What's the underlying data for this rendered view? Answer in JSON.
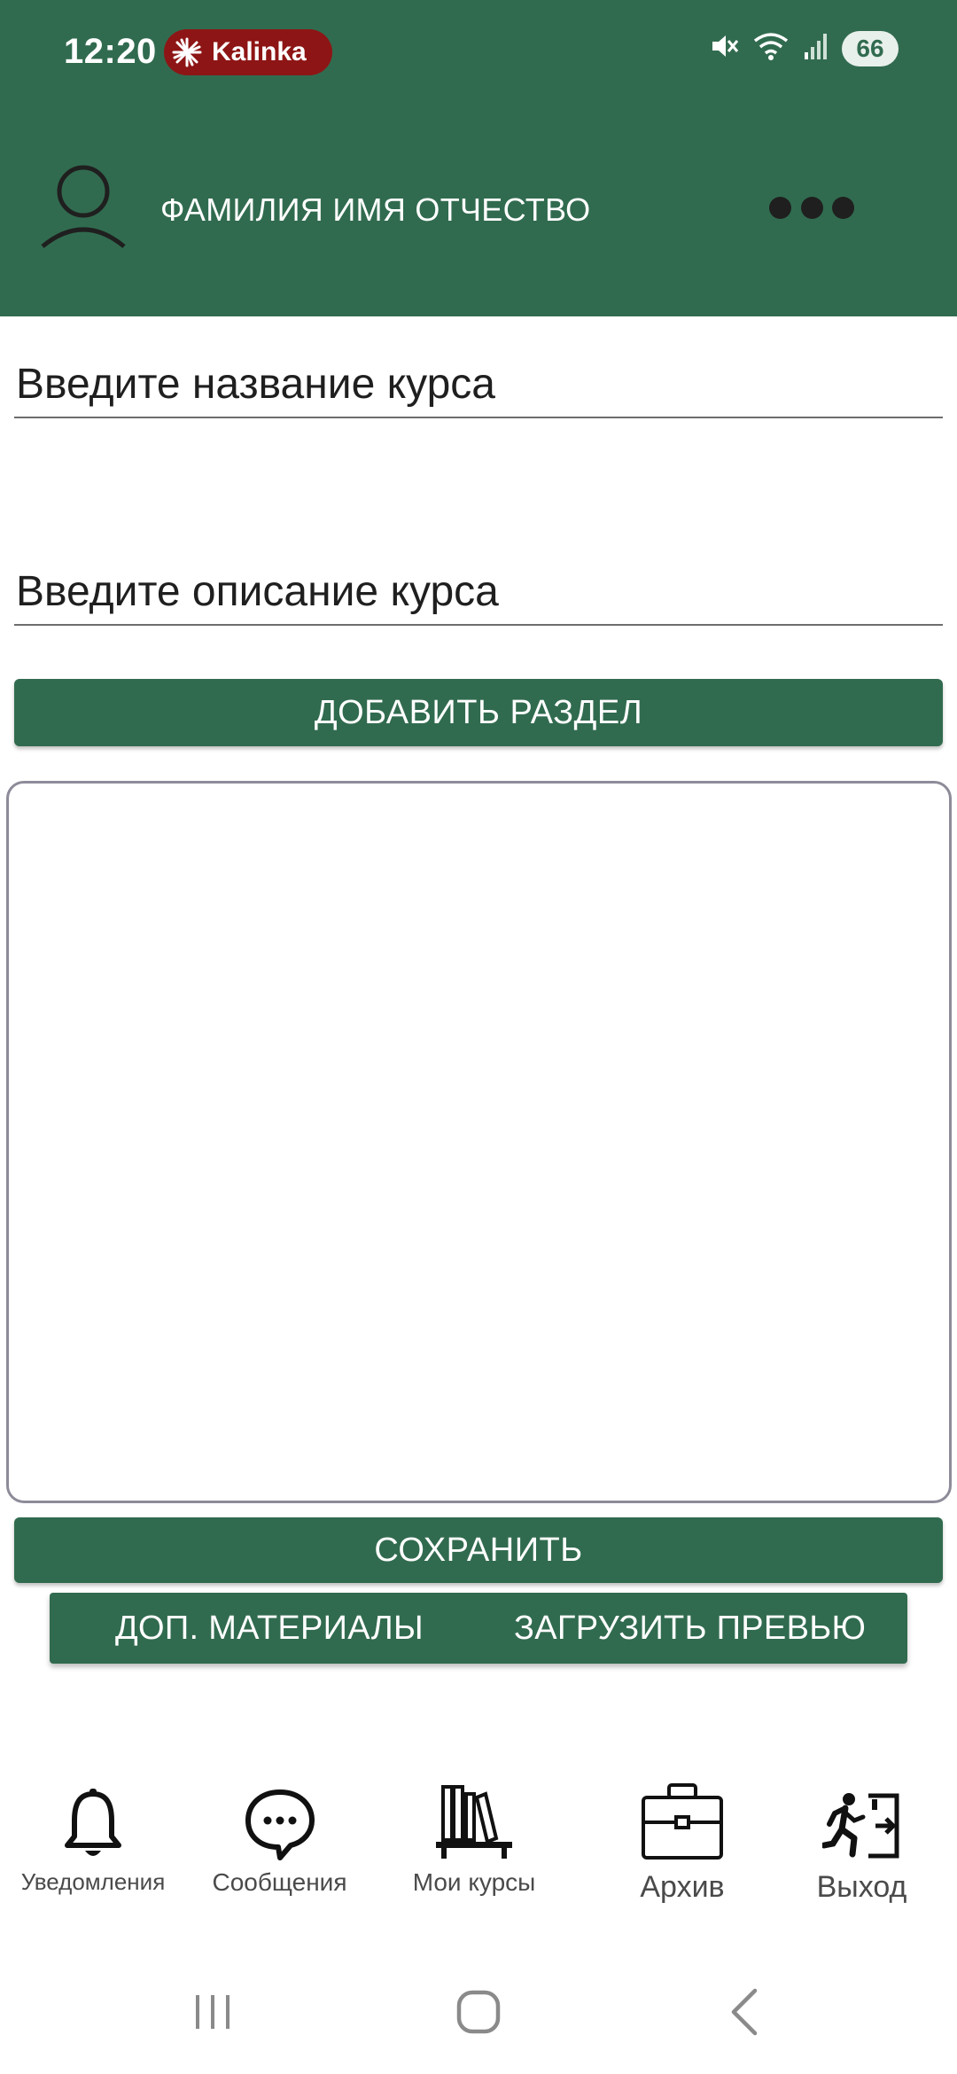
{
  "status_bar": {
    "time": "12:20",
    "app_badge": "Kalinka",
    "battery": "66",
    "icons": [
      "mute-icon",
      "wifi-icon",
      "signal-icon",
      "battery-icon"
    ]
  },
  "header": {
    "user_name": "ФАМИЛИЯ ИМЯ ОТЧЕСТВО",
    "more_icon": "more-dots-icon",
    "avatar_icon": "user-avatar-icon",
    "background_color": "#316B4F"
  },
  "form": {
    "title_placeholder": "Введите название курса",
    "title_value": "",
    "description_placeholder": "Введите описание курса",
    "description_value": "",
    "add_section_label": "ДОБАВИТЬ РАЗДЕЛ",
    "save_label": "СОХРАНИТЬ",
    "extra_materials_label": "ДОП. МАТЕРИАЛЫ",
    "upload_preview_label": "ЗАГРУЗИТЬ ПРЕВЬЮ"
  },
  "bottom_nav": {
    "items": [
      {
        "label": "Уведомления",
        "icon": "bell-icon"
      },
      {
        "label": "Сообщения",
        "icon": "chat-bubble-icon"
      },
      {
        "label": "Мои курсы",
        "icon": "bookshelf-icon"
      },
      {
        "label": "Архив",
        "icon": "briefcase-icon"
      },
      {
        "label": "Выход",
        "icon": "exit-icon"
      }
    ]
  },
  "system_nav": {
    "buttons": [
      "recents-icon",
      "home-icon",
      "back-icon"
    ]
  },
  "colors": {
    "primary": "#316B4F",
    "badge": "#8E1515"
  }
}
